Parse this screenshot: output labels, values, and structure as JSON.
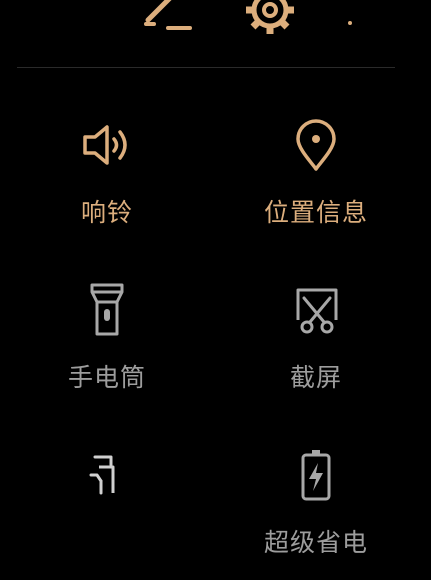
{
  "colors": {
    "active": "#dcae7d",
    "inactive": "#9d9d9d",
    "background": "#000000",
    "divider": "#2a2a2a"
  },
  "header": {
    "icons": [
      "edit-icon",
      "settings-gear-icon",
      "more-dot-icon"
    ]
  },
  "tiles": [
    {
      "id": "ring",
      "label": "响铃",
      "icon": "speaker-volume-icon",
      "active": true
    },
    {
      "id": "location",
      "label": "位置信息",
      "icon": "location-pin-icon",
      "active": true
    },
    {
      "id": "flashlight",
      "label": "手电筒",
      "icon": "flashlight-icon",
      "active": false
    },
    {
      "id": "screenshot",
      "label": "截屏",
      "icon": "screenshot-scissors-icon",
      "active": false
    },
    {
      "id": "rotation",
      "label": "",
      "icon": "auto-rotate-icon",
      "active": false
    },
    {
      "id": "power-saver",
      "label": "超级省电",
      "icon": "battery-bolt-icon",
      "active": false
    }
  ]
}
